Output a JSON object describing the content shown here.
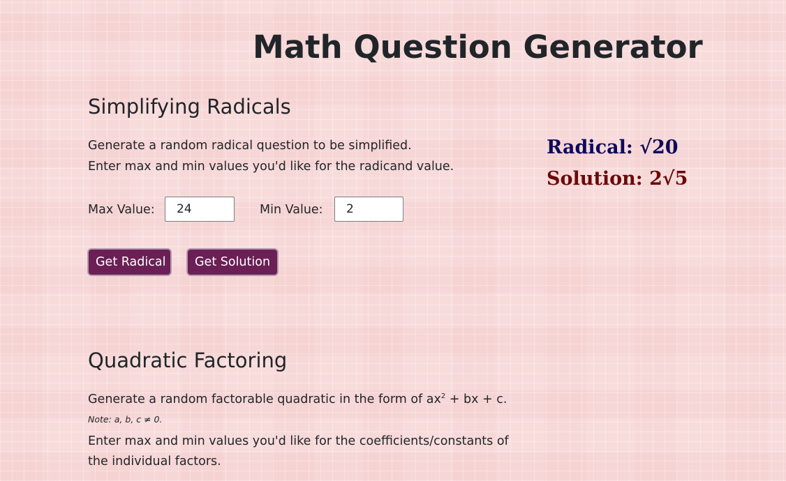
{
  "page": {
    "title": "Math Question Generator"
  },
  "radicals": {
    "heading": "Simplifying Radicals",
    "description_line1": "Generate a random radical question to be simplified.",
    "description_line2": "Enter max and min values you'd like for the radicand value.",
    "max_label": "Max Value:",
    "max_value": "24",
    "min_label": "Min Value:",
    "min_value": "2",
    "get_radical_label": "Get Radical",
    "get_solution_label": "Get Solution",
    "radical_result": "Radical: √20",
    "solution_result": "Solution: 2√5",
    "colors": {
      "radical_result": "#0d0a5c",
      "solution_result": "#6b0a0a",
      "button_bg": "#6b1f55"
    }
  },
  "quadratic": {
    "heading": "Quadratic Factoring",
    "description_prefix": "Generate a random factorable quadratic in the form of ax",
    "description_sup": "2",
    "description_suffix": " + bx + c.",
    "note": "Note: a, b, c ≠ 0.",
    "instruction_line1": "Enter max and min values you'd like for the coefficients/constants of",
    "instruction_line2": "the individual factors."
  }
}
